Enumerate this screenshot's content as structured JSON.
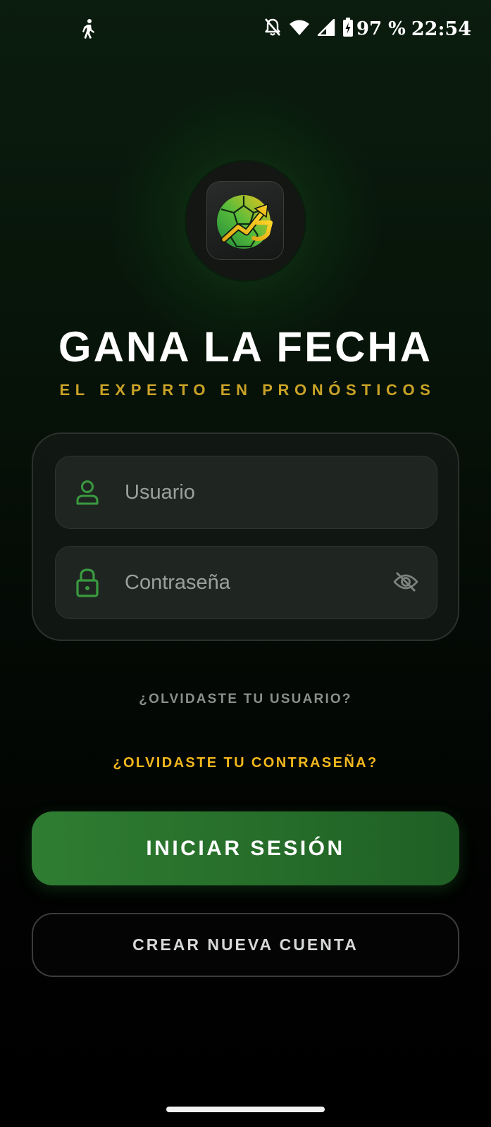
{
  "status_bar": {
    "battery_percent": "97 %",
    "time": "22:54",
    "icons": [
      "walking-icon",
      "bell-off-icon",
      "wifi-icon",
      "signal-icon",
      "battery-charging-icon"
    ]
  },
  "logo": {
    "icon": "soccer-ball-trend-arrow-logo"
  },
  "app": {
    "title": "GANA LA FECHA",
    "subtitle": "EL EXPERTO EN PRONÓSTICOS"
  },
  "form": {
    "username": {
      "placeholder": "Usuario",
      "value": "",
      "icon": "user-icon"
    },
    "password": {
      "placeholder": "Contraseña",
      "value": "",
      "icon": "lock-icon",
      "toggle_icon": "eye-off-icon"
    }
  },
  "links": {
    "forgot_user": "¿OLVIDASTE TU USUARIO?",
    "forgot_password": "¿OLVIDASTE TU CONTRASEÑA?"
  },
  "buttons": {
    "login": "INICIAR SESIÓN",
    "create_account": "CREAR NUEVA CUENTA"
  },
  "colors": {
    "accent_green": "#2f7d33",
    "accent_gold": "#f2b81d",
    "subtitle_gold": "#c9a227",
    "icon_green": "#3a9a3f"
  }
}
